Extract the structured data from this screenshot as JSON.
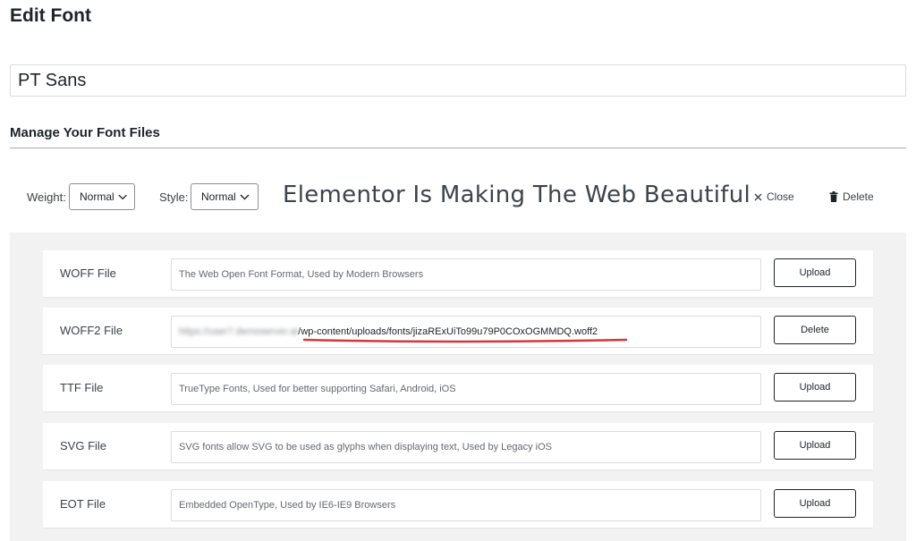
{
  "page": {
    "title": "Edit Font"
  },
  "font_name": {
    "value": "PT Sans"
  },
  "manage_section": {
    "heading": "Manage Your Font Files"
  },
  "variation": {
    "weight_label": "Weight:",
    "weight_value": "Normal",
    "style_label": "Style:",
    "style_value": "Normal",
    "preview_text": "Elementor Is Making The Web Beautiful",
    "close_label": "Close",
    "delete_label": "Delete"
  },
  "files": [
    {
      "label": "WOFF File",
      "placeholder": "The Web Open Font Format, Used by Modern Browsers",
      "value": "",
      "button": "Upload"
    },
    {
      "label": "WOFF2 File",
      "placeholder": "",
      "value_host": "https://user7.demoserver.at",
      "value_path": "/wp-content/uploads/fonts/jizaRExUiTo99u79P0COxOGMMDQ.woff2",
      "button": "Delete"
    },
    {
      "label": "TTF File",
      "placeholder": "TrueType Fonts, Used for better supporting Safari, Android, iOS",
      "value": "",
      "button": "Upload"
    },
    {
      "label": "SVG File",
      "placeholder": "SVG fonts allow SVG to be used as glyphs when displaying text, Used by Legacy iOS",
      "value": "",
      "button": "Upload"
    },
    {
      "label": "EOT File",
      "placeholder": "Embedded OpenType, Used by IE6-IE9 Browsers",
      "value": "",
      "button": "Upload"
    }
  ],
  "colors": {
    "annotation_underline": "#d63638",
    "panel_bg": "#f2f2f2"
  }
}
